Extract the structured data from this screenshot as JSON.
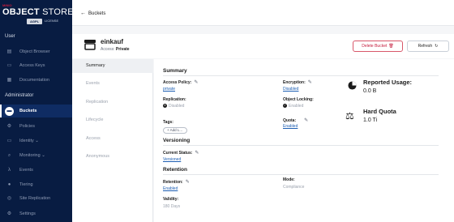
{
  "sidebar": {
    "brand": "MINIO",
    "product_bold": "OBJECT",
    "product_light": "STORE",
    "edition": "AGPL",
    "license": "LICENSE",
    "user_section": "User",
    "admin_section": "Administrator",
    "user_items": [
      {
        "label": "Object Browser",
        "icon": "folder-icon"
      },
      {
        "label": "Access Keys",
        "icon": "key-icon"
      },
      {
        "label": "Documentation",
        "icon": "doc-icon"
      }
    ],
    "admin_items": [
      {
        "label": "Buckets",
        "icon": "bucket-icon"
      },
      {
        "label": "Policies",
        "icon": "policy-icon"
      },
      {
        "label": "Identity",
        "icon": "identity-icon"
      },
      {
        "label": "Monitoring",
        "icon": "monitoring-icon"
      },
      {
        "label": "Events",
        "icon": "lambda-icon"
      },
      {
        "label": "Tiering",
        "icon": "tiering-icon"
      },
      {
        "label": "Site Replication",
        "icon": "replication-icon"
      },
      {
        "label": "Settings",
        "icon": "settings-icon"
      }
    ]
  },
  "topbar": {
    "back_label": "Buckets"
  },
  "bucket": {
    "name": "einkauf",
    "access_label": "Access:",
    "access_value": "Private",
    "delete_label": "Delete Bucket",
    "refresh_label": "Refresh"
  },
  "tabs": [
    "Summary",
    "Events",
    "Replication",
    "Lifecycle",
    "Access",
    "Anonymous"
  ],
  "summary": {
    "summary_title": "Summary",
    "access_policy_label": "Access Policy:",
    "access_policy_value": "private",
    "replication_label": "Replication:",
    "replication_value": "Disabled",
    "tags_label": "Tags:",
    "add_tag_label": "Add L...",
    "encryption_label": "Encryption:",
    "encryption_value": "Disabled",
    "locking_label": "Object Locking:",
    "locking_value": "Enabled",
    "quota_label": "Quota:",
    "quota_value": "Enabled",
    "usage_title": "Reported Usage:",
    "usage_value": "0.0 B",
    "hard_quota_title": "Hard Quota",
    "hard_quota_value": "1.0 Ti",
    "versioning_title": "Versioning",
    "current_status_label": "Current Status:",
    "current_status_value": "Versioned",
    "retention_title": "Retention",
    "retention_label": "Retention:",
    "retention_value": "Enabled",
    "mode_label": "Mode:",
    "mode_value": "Compliance",
    "validity_label": "Validity:",
    "validity_value": "180 Days"
  },
  "colors": {
    "sidebar_bg": "#081c42",
    "active_item_bg": "#0f2c63",
    "delete_red": "#c51b3c",
    "link_blue": "#1e5fb3"
  }
}
